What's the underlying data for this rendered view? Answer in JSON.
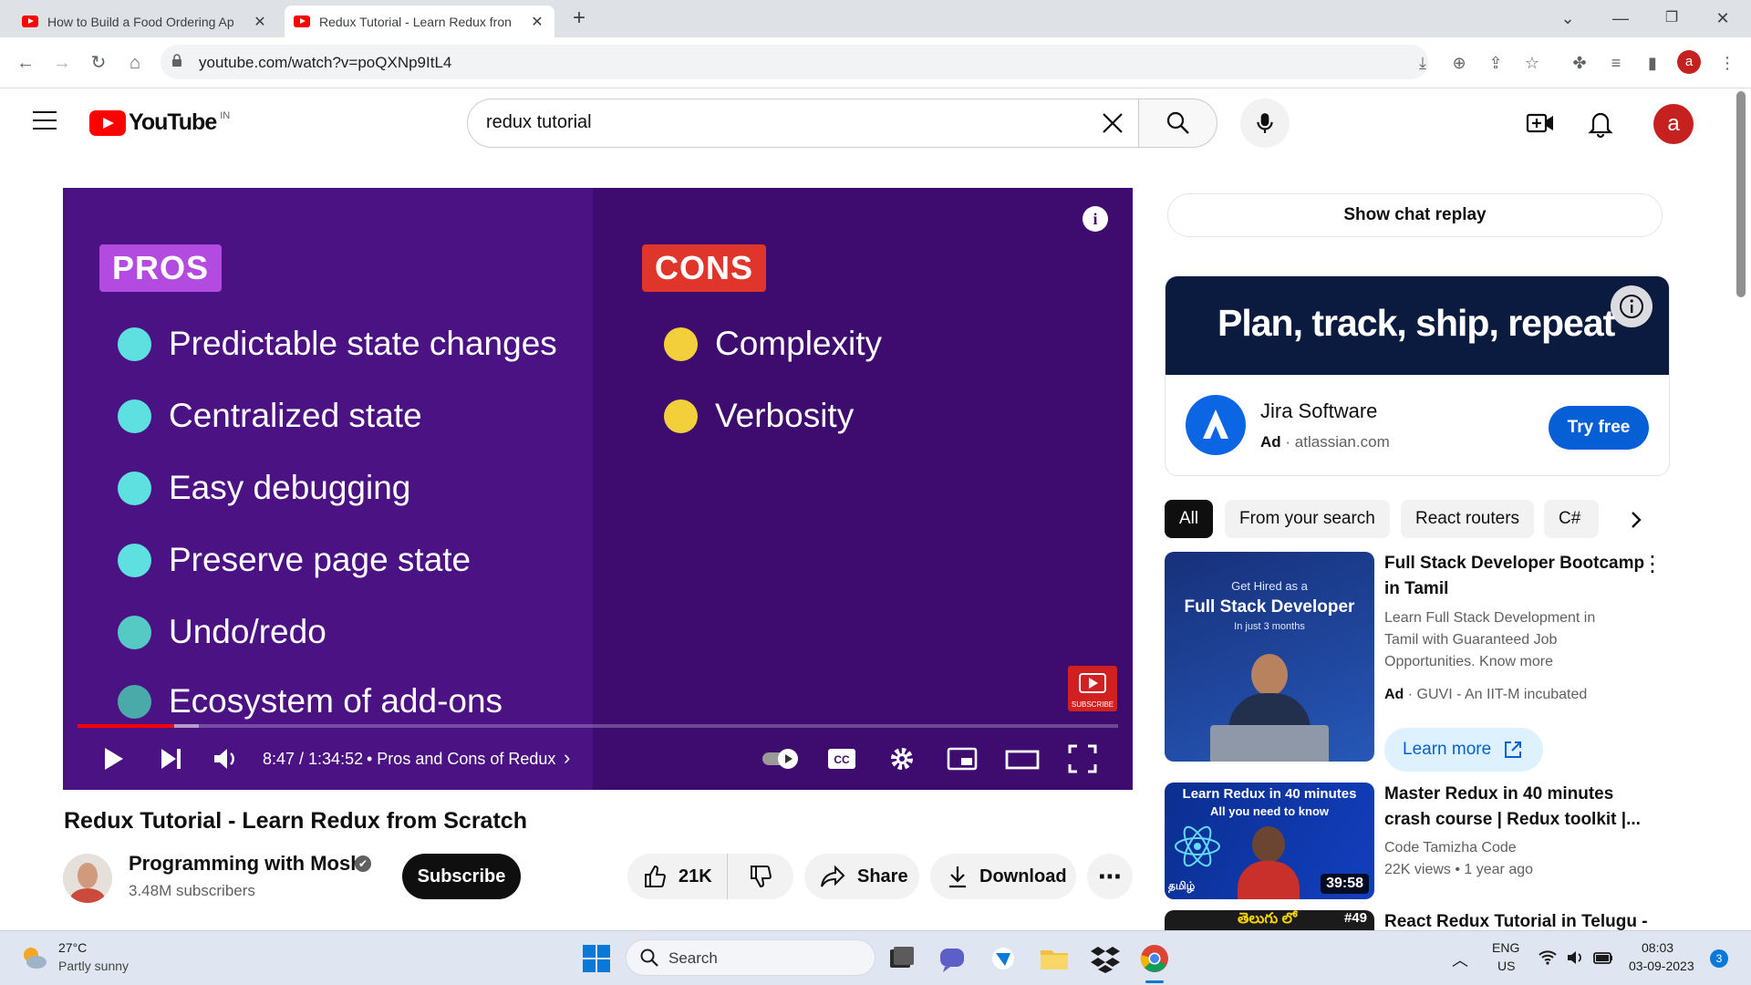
{
  "browser": {
    "tabs": [
      {
        "title": "How to Build a Food Ordering Ap",
        "active": false
      },
      {
        "title": "Redux Tutorial - Learn Redux fron",
        "active": true
      }
    ],
    "new_tab": "+",
    "url": "youtube.com/watch?v=poQXNp9ItL4",
    "profile_initial": "a"
  },
  "youtube": {
    "logo_text": "YouTube",
    "country_code": "IN",
    "search_value": "redux tutorial",
    "avatar_initial": "a"
  },
  "video": {
    "pros_label": "PROS",
    "cons_label": "CONS",
    "pros": [
      "Predictable state changes",
      "Centralized state",
      "Easy debugging",
      "Preserve page state",
      "Undo/redo",
      "Ecosystem of add-ons"
    ],
    "cons": [
      "Complexity",
      "Verbosity"
    ],
    "time": "8:47 / 1:34:52",
    "chapter": "• Pros and Cons of Redux",
    "chapter_arrow": "›",
    "progress_played": 0.093,
    "progress_buffered": 0.117,
    "watermark": "SUBSCRIBE",
    "title": "Redux Tutorial - Learn Redux from Scratch",
    "colors": {
      "pros_tag": "#b44be0",
      "cons_tag": "#e0352b",
      "pros_dot": "#5ee0e0",
      "cons_dot": "#f3cf3b"
    }
  },
  "channel": {
    "name": "Programming with Mosh",
    "verified_icon": "✔",
    "subscribers": "3.48M subscribers",
    "subscribe_label": "Subscribe"
  },
  "actions": {
    "likes": "21K",
    "share": "Share",
    "download": "Download"
  },
  "sidebar": {
    "chat_replay": "Show chat replay",
    "ad": {
      "headline": "Plan, track, ship, repeat",
      "advertiser": "Jira Software",
      "ad_label": "Ad",
      "domain": "· atlassian.com",
      "cta": "Try free"
    },
    "chips": [
      "All",
      "From your search",
      "React routers",
      "C#"
    ],
    "recommendations": [
      {
        "title_line1": "Full Stack Developer Bootcamp",
        "title_line2": "in Tamil",
        "desc_line1": "Learn Full Stack Development in",
        "desc_line2": "Tamil with Guaranteed Job",
        "desc_line3": "Opportunities. Know more",
        "ad_label": "Ad",
        "advertiser": "· GUVI - An IIT-M incubated",
        "cta": "Learn more",
        "thumb_line1": "Get Hired as a",
        "thumb_line2": "Full Stack Developer",
        "thumb_line3": "In just 3 months"
      },
      {
        "title_line1": "Master Redux in 40 minutes",
        "title_line2": "crash course | Redux toolkit |...",
        "channel": "Code Tamizha Code",
        "meta": "22K views • 1 year ago",
        "duration": "39:58",
        "thumb_line1": "Learn Redux in 40 minutes",
        "thumb_line2": "All you need to know",
        "thumb_tag": "தமிழ்"
      },
      {
        "title_line1": "React Redux Tutorial in Telugu -",
        "thumb_tag": "తెలుగు లో",
        "thumb_num": "#49"
      }
    ]
  },
  "taskbar": {
    "weather_temp": "27°C",
    "weather_desc": "Partly sunny",
    "search_label": "Search",
    "lang1": "ENG",
    "lang2": "US",
    "time": "08:03",
    "date": "03-09-2023",
    "notif_count": "3"
  }
}
